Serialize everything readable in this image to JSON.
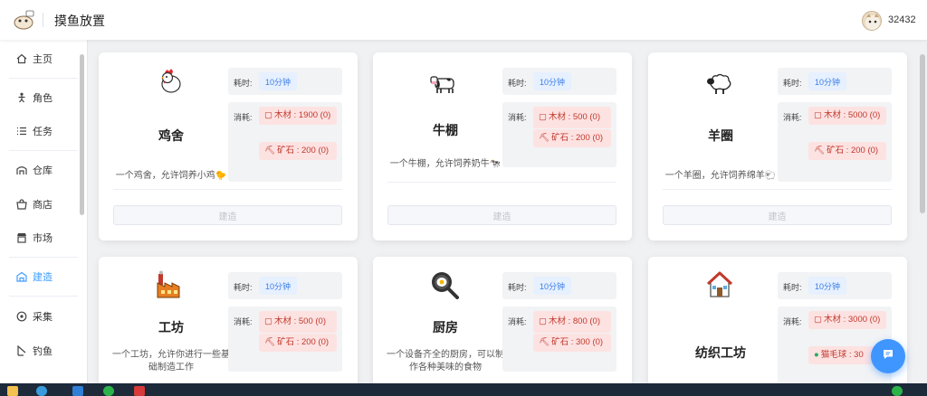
{
  "header": {
    "app_title": "摸鱼放置",
    "user_count": "32432"
  },
  "sidebar": {
    "items": [
      {
        "label": "主页",
        "icon": "home-icon"
      },
      {
        "label": "角色",
        "icon": "person-icon"
      },
      {
        "label": "任务",
        "icon": "list-icon"
      },
      {
        "label": "仓库",
        "icon": "warehouse-icon"
      },
      {
        "label": "商店",
        "icon": "shop-icon"
      },
      {
        "label": "市场",
        "icon": "market-icon"
      },
      {
        "label": "建造",
        "icon": "build-icon",
        "active": true
      },
      {
        "label": "采集",
        "icon": "gather-icon"
      },
      {
        "label": "钓鱼",
        "icon": "fishing-icon"
      }
    ]
  },
  "labels": {
    "time": "耗时:",
    "cost": "消耗:",
    "build_button": "建造"
  },
  "buildings": [
    {
      "name": "鸡舍",
      "icon": "chicken-icon",
      "desc": "一个鸡舍，允许饲养小鸡🐤",
      "time": "10分钟",
      "costs": [
        {
          "icon": "wood-icon",
          "text": "木材 : 1900 (0)"
        },
        {
          "icon": "pickaxe-icon",
          "text": "矿石 : 200 (0)"
        }
      ]
    },
    {
      "name": "牛棚",
      "icon": "cow-icon",
      "desc": "一个牛棚，允许饲养奶牛🐄",
      "time": "10分钟",
      "costs": [
        {
          "icon": "wood-icon",
          "text": "木材 : 500 (0)"
        },
        {
          "icon": "pickaxe-icon",
          "text": "矿石 : 200 (0)"
        }
      ]
    },
    {
      "name": "羊圈",
      "icon": "sheep-icon",
      "desc": "一个羊圈，允许饲养绵羊🐑",
      "time": "10分钟",
      "costs": [
        {
          "icon": "wood-icon",
          "text": "木材 : 5000 (0)"
        },
        {
          "icon": "pickaxe-icon",
          "text": "矿石 : 200 (0)"
        }
      ]
    },
    {
      "name": "工坊",
      "icon": "factory-icon",
      "desc": "一个工坊，允许你进行一些基础制造工作",
      "time": "10分钟",
      "costs": [
        {
          "icon": "wood-icon",
          "text": "木材 : 500 (0)"
        },
        {
          "icon": "pickaxe-icon",
          "text": "矿石 : 200 (0)"
        }
      ]
    },
    {
      "name": "厨房",
      "icon": "frying-pan-icon",
      "desc": "一个设备齐全的厨房，可以制作各种美味的食物",
      "time": "10分钟",
      "costs": [
        {
          "icon": "wood-icon",
          "text": "木材 : 800 (0)"
        },
        {
          "icon": "pickaxe-icon",
          "text": "矿石 : 300 (0)"
        }
      ]
    },
    {
      "name": "纺织工坊",
      "icon": "house-icon",
      "desc": "",
      "time": "10分钟",
      "costs": [
        {
          "icon": "wood-icon",
          "text": "木材 : 3000 (0)"
        },
        {
          "icon": "yarn-icon",
          "text": "猫毛球 : 30"
        }
      ]
    }
  ],
  "colors": {
    "accent": "#409eff",
    "time_tag_bg": "#e6f0ff",
    "cost_tag_bg": "#fde2e2",
    "cost_tag_text": "#c0392b"
  }
}
